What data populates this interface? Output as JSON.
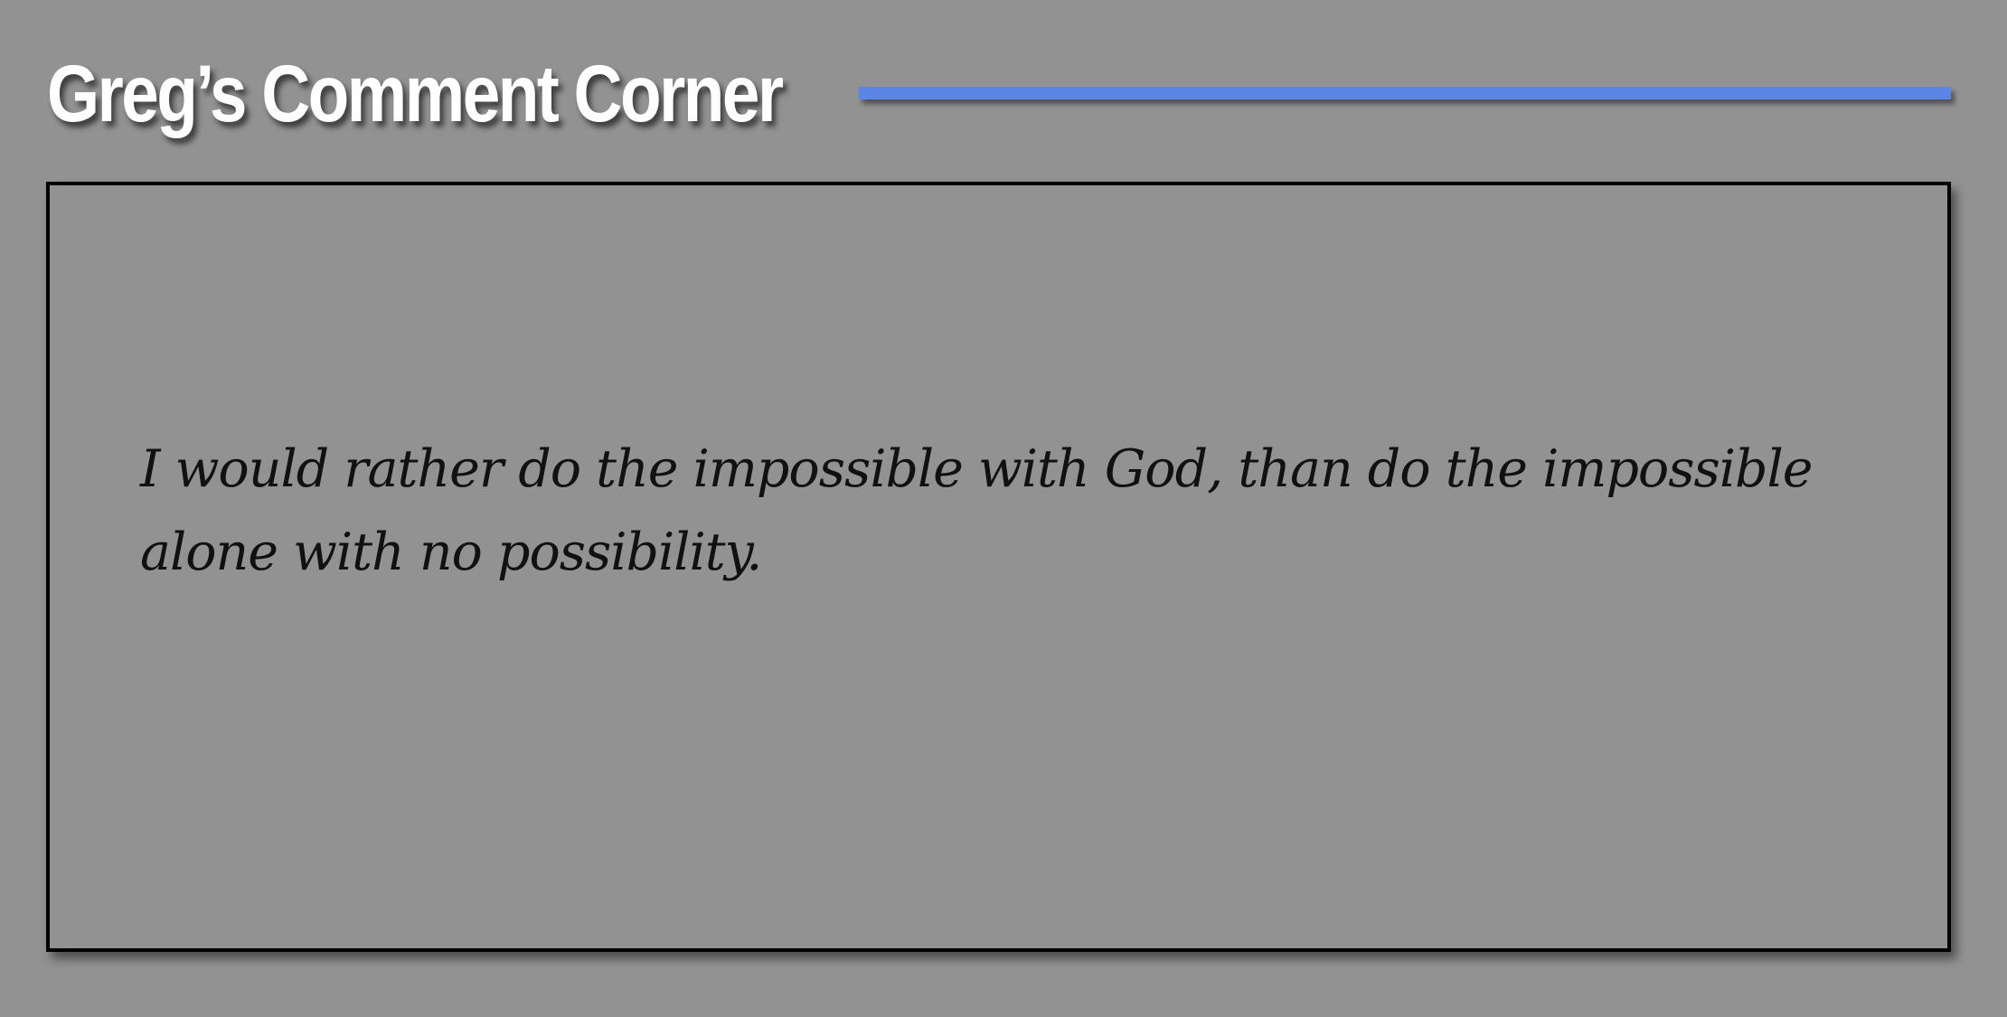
{
  "header": {
    "title": "Greg’s Comment Corner"
  },
  "comment": {
    "text": "I would rather do the impossible with God, than do the impossible alone with no possibility."
  },
  "colors": {
    "background": "#929292",
    "title": "#ffffff",
    "accent_rule": "#5b86e8",
    "frame_border": "#000000",
    "quote_text": "#111111"
  }
}
